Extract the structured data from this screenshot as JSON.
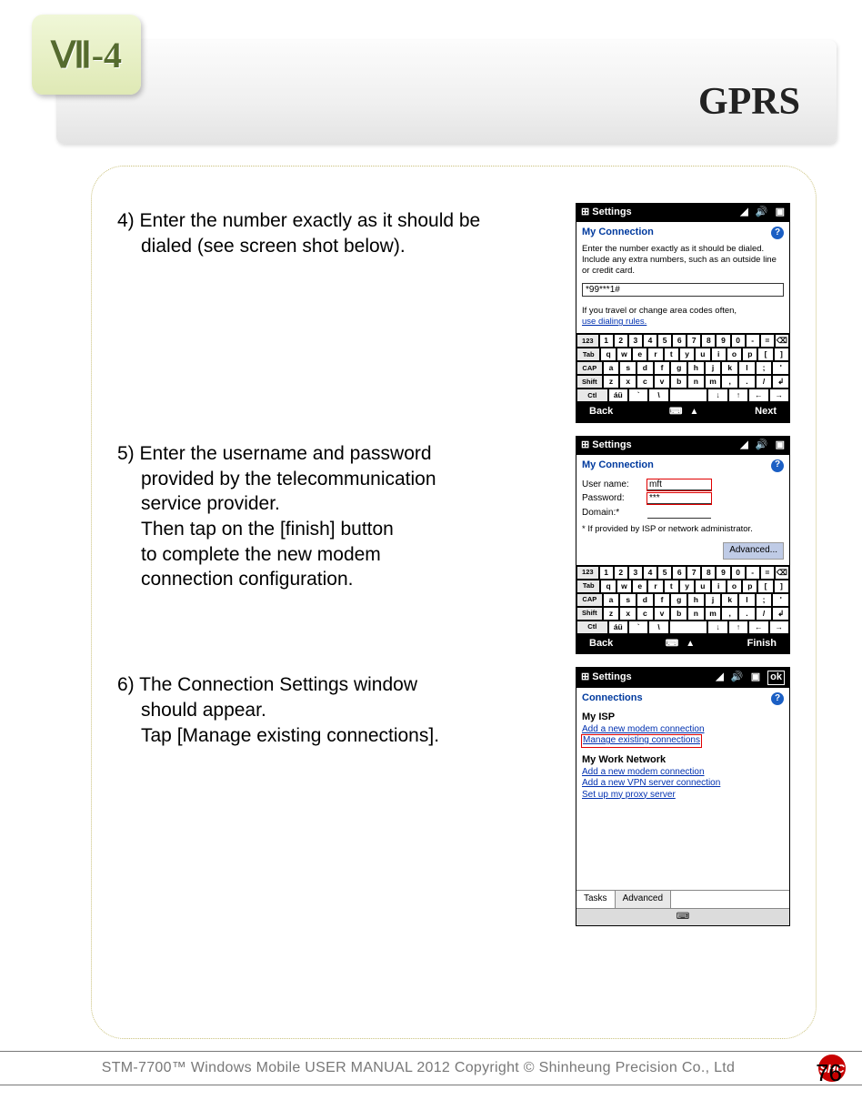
{
  "header": {
    "section_number": "Ⅶ-4",
    "title": "GPRS"
  },
  "steps": {
    "s4": {
      "num": "4)",
      "line1": "Enter the number exactly as it should be",
      "line2": "dialed (see screen shot below)."
    },
    "s5": {
      "num": "5)",
      "l1": "Enter the username and password",
      "l2": "provided by the telecommunication",
      "l3": "service provider.",
      "l4": "Then tap on the [finish] button",
      "l5": "to complete the new modem",
      "l6": "connection configuration."
    },
    "s6": {
      "num": "6)",
      "l1": "The Connection Settings window",
      "l2": "should appear.",
      "l3": "Tap [Manage existing connections]."
    }
  },
  "phone1": {
    "app_title": "Settings",
    "page": "My Connection",
    "desc": "Enter the number exactly as it should be dialed. Include any extra numbers, such as an outside line or credit card.",
    "dial_value": "*99***1#",
    "note": "If you travel or change area codes often,",
    "dial_rules_link": "use dialing rules.",
    "soft_left": "Back",
    "soft_right": "Next"
  },
  "phone2": {
    "app_title": "Settings",
    "page": "My Connection",
    "user_label": "User name:",
    "user_value": "mft",
    "pass_label": "Password:",
    "pass_value": "***",
    "domain_label": "Domain:*",
    "isp_note": "* If provided by ISP or network administrator.",
    "advanced": "Advanced...",
    "soft_left": "Back",
    "soft_right": "Finish"
  },
  "phone3": {
    "app_title": "Settings",
    "ok": "ok",
    "page": "Connections",
    "isp_title": "My ISP",
    "isp_link1": "Add a new modem connection",
    "isp_link2": "Manage existing connections",
    "work_title": "My Work Network",
    "work_link1": "Add a new modem connection",
    "work_link2": "Add a new VPN server connection",
    "work_link3": "Set up my proxy server",
    "tab1": "Tasks",
    "tab2": "Advanced"
  },
  "keyboard": {
    "r1": [
      "123",
      "1",
      "2",
      "3",
      "4",
      "5",
      "6",
      "7",
      "8",
      "9",
      "0",
      "-",
      "=",
      "⌫"
    ],
    "r2": [
      "Tab",
      "q",
      "w",
      "e",
      "r",
      "t",
      "y",
      "u",
      "i",
      "o",
      "p",
      "[",
      "]"
    ],
    "r3": [
      "CAP",
      "a",
      "s",
      "d",
      "f",
      "g",
      "h",
      "j",
      "k",
      "l",
      ";",
      "'"
    ],
    "r4": [
      "Shift",
      "z",
      "x",
      "c",
      "v",
      "b",
      "n",
      "m",
      ",",
      ".",
      "/",
      "↲"
    ],
    "r5": [
      "Ctl",
      "áü",
      "`",
      "\\",
      " ",
      "↓",
      "↑",
      "←",
      "→"
    ]
  },
  "footer": {
    "text": "STM-7700™ Windows Mobile USER MANUAL  2012 Copyright © Shinheung Precision Co., Ltd",
    "logo": "SHC",
    "page": "76"
  },
  "icons": {
    "win": "⊞",
    "signal": "◢",
    "speaker": "🔊",
    "battery": "▣",
    "kbd": "⌨",
    "up": "▲"
  }
}
